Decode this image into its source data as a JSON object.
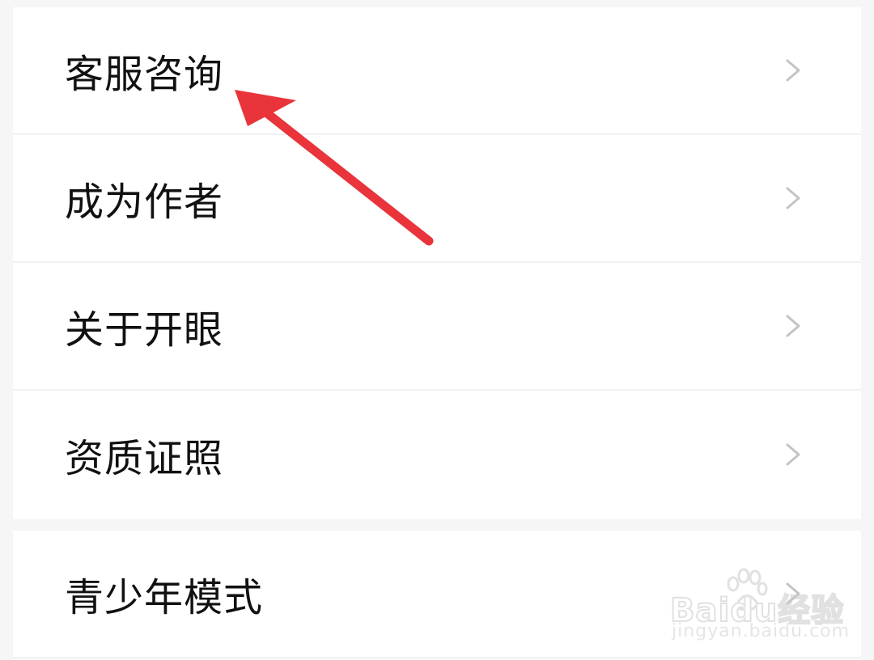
{
  "menu": {
    "group1": [
      {
        "label": "客服咨询",
        "icon": "chevron-right-icon"
      },
      {
        "label": "成为作者",
        "icon": "chevron-right-icon"
      },
      {
        "label": "关于开眼",
        "icon": "chevron-right-icon"
      },
      {
        "label": "资质证照",
        "icon": "chevron-right-icon"
      }
    ],
    "group2": [
      {
        "label": "青少年模式",
        "icon": "chevron-right-icon"
      }
    ]
  },
  "annotation": {
    "type": "red-arrow",
    "color": "#e8343a",
    "points_to": "客服咨询"
  },
  "watermark": {
    "main": "Baidu经验",
    "sub": "jingyan.baidu.com"
  },
  "colors": {
    "background": "#f6f6f6",
    "row": "#ffffff",
    "text": "#111111",
    "chevron": "#c4c4c4",
    "divider": "#f1f1f1"
  }
}
